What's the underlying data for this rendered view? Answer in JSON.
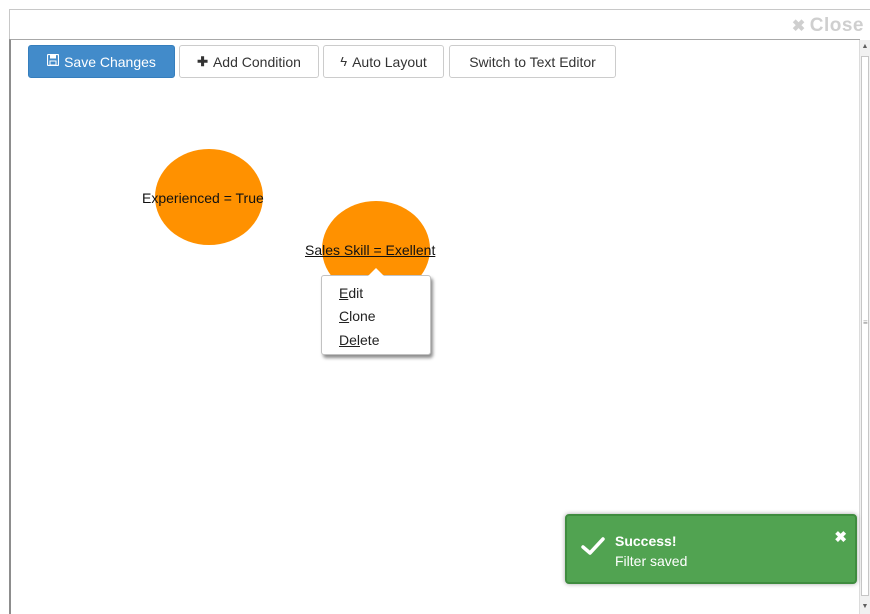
{
  "dialog": {
    "close_label": "Close",
    "close_icon": "close-icon"
  },
  "toolbar": {
    "save_label": "Save Changes",
    "save_icon": "floppy-disk-icon",
    "add_condition_label": "Add Condition",
    "add_condition_icon": "plus-icon",
    "auto_layout_label": "Auto Layout",
    "auto_layout_icon": "lightning-bolt-icon",
    "text_editor_label": "Switch to Text Editor"
  },
  "graph": {
    "nodes": [
      {
        "label": "Experienced = True",
        "color": "#ff9100"
      },
      {
        "label": "Sales Skill = Exellent",
        "color": "#ff9100",
        "selected": true
      }
    ]
  },
  "context_menu": {
    "items": [
      {
        "accel": "E",
        "rest": "dit"
      },
      {
        "accel": "C",
        "rest": "lone"
      },
      {
        "accel": "Del",
        "rest": "ete"
      }
    ]
  },
  "toast": {
    "title": "Success!",
    "message": "Filter saved",
    "color": "#51a351",
    "icon": "checkmark-icon",
    "close_icon": "close-icon"
  }
}
